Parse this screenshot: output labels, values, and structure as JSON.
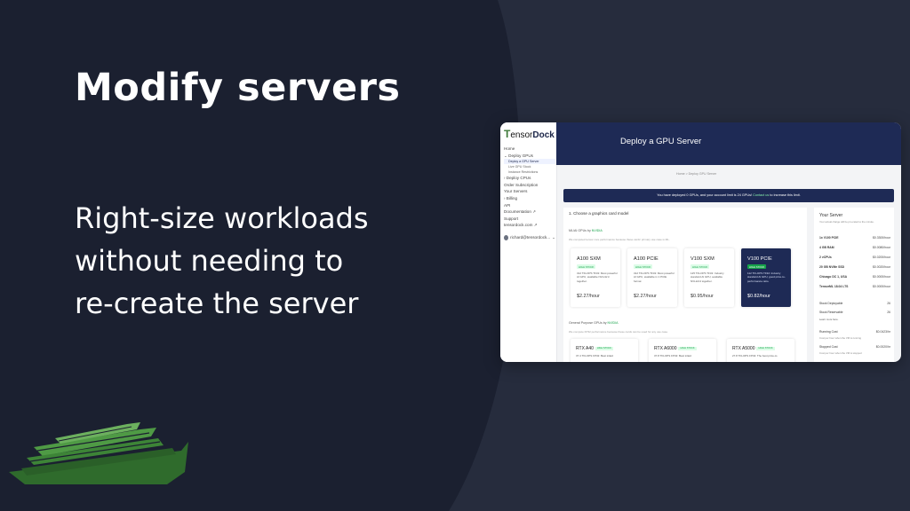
{
  "slide": {
    "headline": "Modify servers",
    "subline": [
      "Right-size workloads",
      "without needing to",
      "re-create the server"
    ],
    "colors": {
      "background": "#1b2030",
      "background_alt": "#262c3d",
      "accent": "#1e2a55",
      "green": "#16a34a"
    }
  },
  "app": {
    "logo_prefix": "T",
    "logo_mid": "ensor",
    "logo_suffix": "Dock",
    "page_title": "Deploy a GPU Server",
    "breadcrumb": "Home  >  Deploy GPU Server",
    "banner_text": "You have deployed 0 GPUs, and your account limit is 24 GPUs!",
    "banner_link": "Contact us",
    "banner_suffix": "to increase this limit."
  },
  "sidebar": {
    "items": [
      {
        "label": "Home",
        "icon": "home-icon"
      },
      {
        "label": "⌄ Deploy GPUs",
        "icon": "chevron-down-icon"
      },
      {
        "label": "Deploy a GPU Server",
        "sub": true,
        "active": true
      },
      {
        "label": "Live GPU Stock",
        "sub": true
      },
      {
        "label": "Instance Restrictions",
        "sub": true
      },
      {
        "label": "› Deploy CPUs",
        "icon": "chevron-right-icon"
      },
      {
        "label": "Order Subscription"
      },
      {
        "label": "Your Servers"
      },
      {
        "label": "› Billing",
        "icon": "chevron-right-icon"
      },
      {
        "label": "API"
      },
      {
        "label": "Documentation ↗",
        "icon": "external-link-icon"
      },
      {
        "label": "Support"
      },
      {
        "label": "tensordock.com ↗",
        "icon": "external-link-icon"
      }
    ],
    "user": "richard@tensordock..."
  },
  "step": {
    "heading": "1. Choose a graphics card model",
    "ml_label": "ML/AI GPUs by",
    "ml_vendor": "NVIDIA",
    "ml_note": "We computed tensor core performance because these cards' primary use case is ML.",
    "gp_label": "General Purpose GPUs by",
    "gp_vendor": "NVIDIA",
    "gp_note": "We compute FP32 performance because these cards can be used for any use case."
  },
  "ml_gpus": [
    {
      "name": "A100 SXM",
      "tag": "HIGH STOCK",
      "desc": "312 TFLOPS TF32: Most powerful AI GPU, available NVLink'd together.",
      "price": "$2.27/hour",
      "selected": false
    },
    {
      "name": "A100 PCIE",
      "tag": "HIGH STOCK",
      "desc": "312 TFLOPS TF32: Most powerful AI GPU, available in 1 PCIE format",
      "price": "$2.27/hour",
      "selected": false
    },
    {
      "name": "V100 SXM",
      "tag": "HIGH STOCK",
      "desc": "125 TFLOPS TF32: Industry standard AI GPU, available NVLink'd together.",
      "price": "$0.95/hour",
      "selected": false
    },
    {
      "name": "V100 PCIE",
      "tag": "HIGH STOCK",
      "desc": "112 TFLOPS TF32: Industry standard AI GPU, good price-to-performance ratio.",
      "price": "$0.82/hour",
      "selected": true
    }
  ],
  "gp_gpus": [
    {
      "name": "RTX A40",
      "tag": "HIGH STOCK",
      "desc": "37.4 TFLOPS FP32: Best inlaid"
    },
    {
      "name": "RTX A6000",
      "tag": "HIGH STOCK",
      "desc": "37.8 TFLOPS FP32: Best inlaid"
    },
    {
      "name": "RTX A5000",
      "tag": "HIGH STOCK",
      "desc": "27.8 TFLOPS FP32: The best price-to"
    }
  ],
  "summary": {
    "heading": "Your Server",
    "subtitle": "Your actual charge will be pro-rated to the minute.",
    "lines": [
      {
        "k": "1x V100 PCIE",
        "v": "$0.3300/hour"
      },
      {
        "k": "4 GB RAM",
        "v": "$0.0080/hour"
      },
      {
        "k": "2 vCPUs",
        "v": "$0.0200/hour"
      },
      {
        "k": "20 GB NVMe SSD",
        "v": "$0.0020/hour"
      },
      {
        "k": "Chicago DC 1, USA",
        "v": "$0.0000/hour"
      },
      {
        "k": "TensorML 18.04 LTS",
        "v": "$0.0000/hour"
      }
    ],
    "stock_deployable_label": "Stock Deployable",
    "stock_deployable_value": "26",
    "stock_reservable_label": "Stock Reservable",
    "stock_reservable_value": "26",
    "learn_more": "Learn more here.",
    "running_cost_label": "Running Cost",
    "running_cost_value": "$0.0423/hr",
    "running_cost_note": "Cost per hour when the VM is running",
    "stopped_cost_label": "Stopped Cost",
    "stopped_cost_value": "$0.0020/hr",
    "stopped_cost_note": "Cost per hour when the VM is stopped"
  }
}
